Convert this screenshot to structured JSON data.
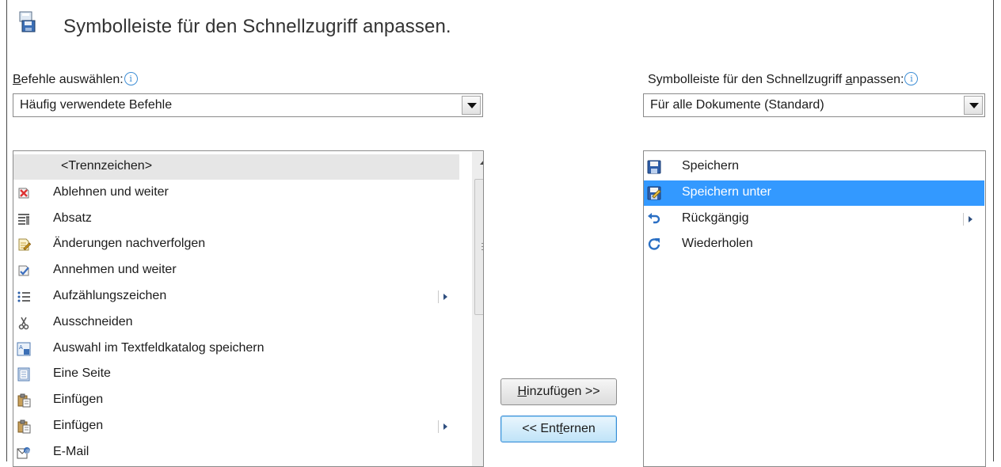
{
  "header": {
    "title": "Symbolleiste für den Schnellzugriff anpassen."
  },
  "left": {
    "label_first": "B",
    "label_rest": "efehle auswählen:",
    "info": "i",
    "combo_value": "Häufig verwendete Befehle",
    "items": [
      {
        "label": "<Trennzeichen>",
        "icon": "separator",
        "selected": true,
        "submenu": false
      },
      {
        "label": "Ablehnen und weiter",
        "icon": "reject-change-icon",
        "submenu": false
      },
      {
        "label": "Absatz",
        "icon": "paragraph-icon",
        "submenu": false
      },
      {
        "label": "Änderungen nachverfolgen",
        "icon": "track-changes-icon",
        "submenu": false
      },
      {
        "label": "Annehmen und weiter",
        "icon": "accept-change-icon",
        "submenu": false
      },
      {
        "label": "Aufzählungszeichen",
        "icon": "bullets-icon",
        "submenu": true
      },
      {
        "label": "Ausschneiden",
        "icon": "scissors-icon",
        "submenu": false
      },
      {
        "label": "Auswahl im Textfeldkatalog speichern",
        "icon": "textbox-gallery-icon",
        "submenu": false
      },
      {
        "label": "Eine Seite",
        "icon": "one-page-icon",
        "submenu": false
      },
      {
        "label": "Einfügen",
        "icon": "paste-icon",
        "submenu": false
      },
      {
        "label": "Einfügen",
        "icon": "paste-icon",
        "submenu": true
      },
      {
        "label": "E-Mail",
        "icon": "email-icon",
        "submenu": false
      }
    ]
  },
  "right": {
    "label_a": "Symbolleiste für den Schnellzugriff ",
    "label_u": "a",
    "label_b": "npassen:",
    "info": "i",
    "combo_value": "Für alle Dokumente (Standard)",
    "items": [
      {
        "label": "Speichern",
        "icon": "save-icon",
        "selected": false,
        "submenu": false
      },
      {
        "label": "Speichern unter",
        "icon": "save-as-icon",
        "selected": true,
        "submenu": false
      },
      {
        "label": "Rückgängig",
        "icon": "undo-icon",
        "selected": false,
        "submenu": true
      },
      {
        "label": "Wiederholen",
        "icon": "redo-icon",
        "selected": false,
        "submenu": false
      }
    ]
  },
  "buttons": {
    "add_u": "H",
    "add_rest": "inzufügen >>",
    "remove_a": "<< Ent",
    "remove_u": "f",
    "remove_b": "ernen"
  },
  "colors": {
    "selection": "#3399ff",
    "separator_row": "#e6e6e6",
    "accent_border": "#3a8bd6"
  }
}
